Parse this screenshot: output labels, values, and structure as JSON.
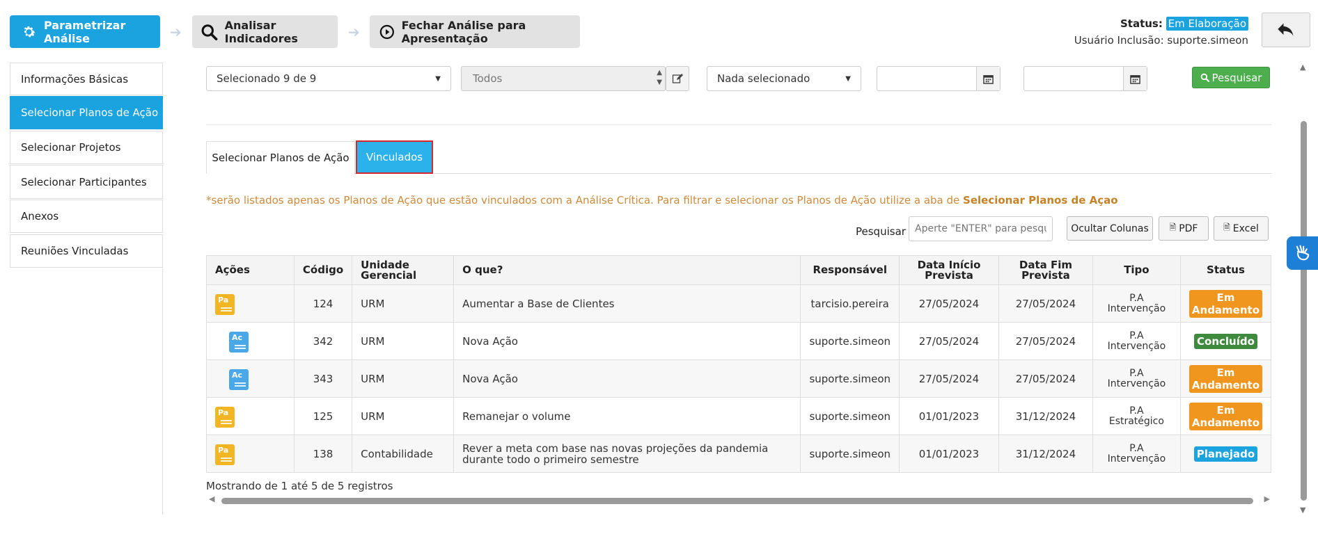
{
  "steps": [
    {
      "label": "Parametrizar Análise",
      "icon": "gear-icon"
    },
    {
      "label": "Analisar Indicadores",
      "icon": "search-icon"
    },
    {
      "label": "Fechar Análise para Apresentação",
      "icon": "play-circle-icon"
    }
  ],
  "status": {
    "label": "Status:",
    "value": "Em Elaboração",
    "user_label": "Usuário Inclusão:",
    "user": "suporte.simeon"
  },
  "sidebar": {
    "items": [
      {
        "label": "Informações Básicas"
      },
      {
        "label": "Selecionar Planos de Ação"
      },
      {
        "label": "Selecionar Projetos"
      },
      {
        "label": "Selecionar Participantes"
      },
      {
        "label": "Anexos"
      },
      {
        "label": "Reuniões Vinculadas"
      }
    ]
  },
  "filters": {
    "select1": "Selecionado 9 de 9",
    "todos_placeholder": "Todos",
    "select2": "Nada selecionado",
    "search_button": "Pesquisar"
  },
  "tabs": [
    {
      "label": "Selecionar Planos de Ação"
    },
    {
      "label": "Vinculados"
    }
  ],
  "note": {
    "text": "*serão listados apenas os Planos de Ação que estão vinculados com a Análise Crítica. Para filtrar e selecionar os Planos de Ação utilize a aba de ",
    "link": "Selecionar Planos de Açao"
  },
  "toolbar": {
    "search_label": "Pesquisar",
    "search_placeholder": "Aperte \"ENTER\" para pesquisar",
    "hide_columns": "Ocultar Colunas",
    "pdf": "PDF",
    "excel": "Excel"
  },
  "table": {
    "headers": [
      "Ações",
      "Código",
      "Unidade Gerencial",
      "O que?",
      "Responsável",
      "Data Início Prevista",
      "Data Fim Prevista",
      "Tipo",
      "Status"
    ],
    "rows": [
      {
        "icon": "Pa",
        "codigo": "124",
        "unidade": "URM",
        "oque": "Aumentar a Base de Clientes",
        "responsavel": "tarcisio.pereira",
        "inicio": "27/05/2024",
        "fim": "27/05/2024",
        "tipo1": "P.A",
        "tipo2": "Intervenção",
        "status": "Em Andamento",
        "status_color": "#f0961e"
      },
      {
        "icon": "Ac",
        "codigo": "342",
        "unidade": "URM",
        "oque": "Nova Ação",
        "responsavel": "suporte.simeon",
        "inicio": "27/05/2024",
        "fim": "27/05/2024",
        "tipo1": "P.A",
        "tipo2": "Intervenção",
        "status": "Concluído",
        "status_color": "#3f8a3f"
      },
      {
        "icon": "Ac",
        "codigo": "343",
        "unidade": "URM",
        "oque": "Nova Ação",
        "responsavel": "suporte.simeon",
        "inicio": "27/05/2024",
        "fim": "27/05/2024",
        "tipo1": "P.A",
        "tipo2": "Intervenção",
        "status": "Em Andamento",
        "status_color": "#f0961e"
      },
      {
        "icon": "Pa",
        "codigo": "125",
        "unidade": "URM",
        "oque": "Remanejar o volume",
        "responsavel": "suporte.simeon",
        "inicio": "01/01/2023",
        "fim": "31/12/2024",
        "tipo1": "P.A",
        "tipo2": "Estratégico",
        "status": "Em Andamento",
        "status_color": "#f0961e"
      },
      {
        "icon": "Pa",
        "codigo": "138",
        "unidade": "Contabilidade",
        "oque": "Rever a meta com base nas novas projeções da pandemia durante todo o primeiro semestre",
        "responsavel": "suporte.simeon",
        "inicio": "01/01/2023",
        "fim": "31/12/2024",
        "tipo1": "P.A",
        "tipo2": "Intervenção",
        "status": "Planejado",
        "status_color": "#1ba3e0"
      }
    ]
  },
  "footer": {
    "text": "Mostrando de 1 até 5 de 5 registros"
  },
  "colors": {
    "accent": "#1ba3e0",
    "green": "#4cae4c",
    "orange_text": "#d08a3a"
  }
}
